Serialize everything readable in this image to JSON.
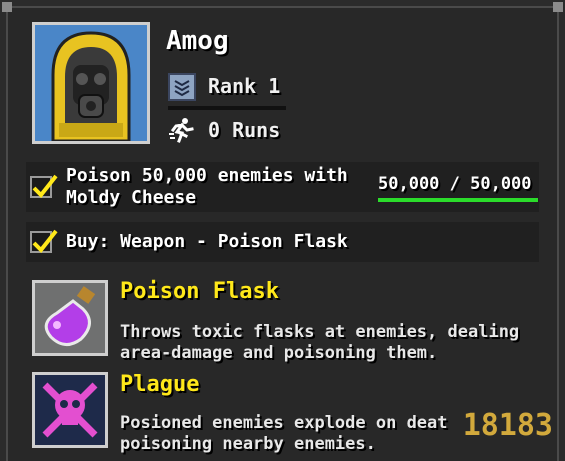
{
  "character": {
    "name": "Amog",
    "rank_label": "Rank 1",
    "runs_label": "0 Runs"
  },
  "tasks": [
    {
      "text": "Poison 50,000 enemies with Moldy Cheese",
      "progress_text": "50,000 / 50,000",
      "progress": 1.0,
      "completed": true
    },
    {
      "text": "Buy: Weapon - Poison Flask",
      "completed": true
    }
  ],
  "items": [
    {
      "title": "Poison Flask",
      "description": "Throws toxic flasks at enemies, dealing area-damage and poisoning them.",
      "icon": "poison-flask-icon"
    },
    {
      "title": "Plague",
      "description": "Posioned enemies explode on deat poisoning nearby enemies.",
      "icon": "skull-crossbones-icon"
    }
  ],
  "watermark": "18183",
  "colors": {
    "accent_yellow": "#ffe81a",
    "progress_green": "#2bdc2b",
    "portrait_bg": "#4a86c8"
  }
}
